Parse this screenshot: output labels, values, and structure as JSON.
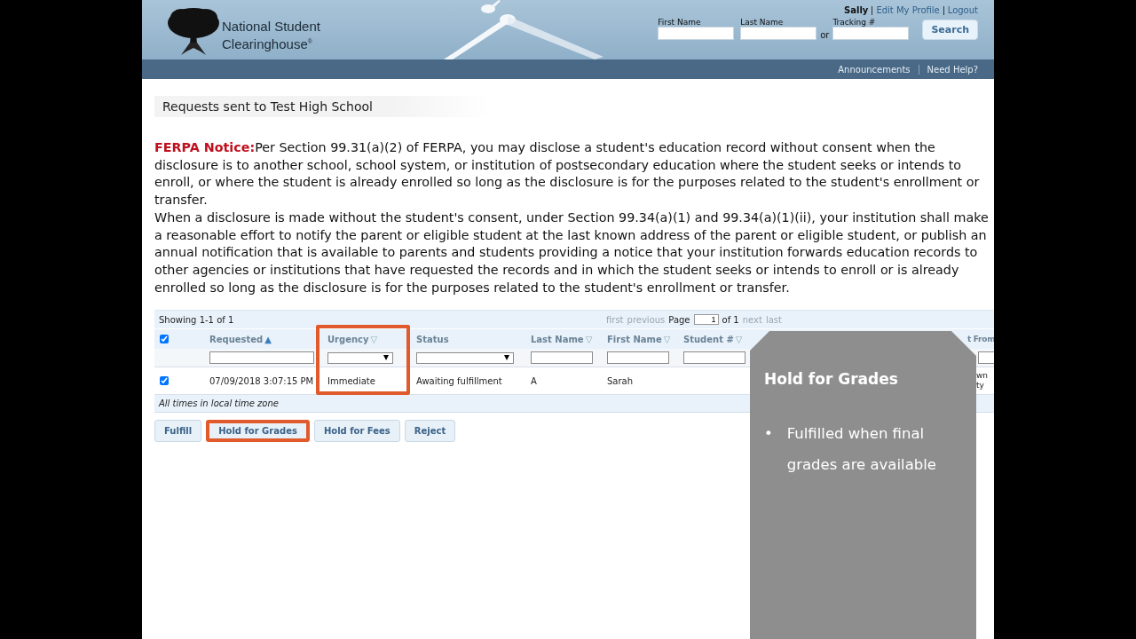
{
  "header": {
    "logo_lines": [
      "National Student",
      "Clearinghouse$^{®}$"
    ],
    "user": "Sally",
    "links": [
      "Edit My Profile",
      "Logout"
    ],
    "search_fields": [
      {
        "label": "First Name"
      },
      {
        "label": "Last Name"
      },
      {
        "label": "Tracking #"
      }
    ],
    "or": "or",
    "search_button": "Search"
  },
  "nav_links": [
    "Announcements",
    "Need Help?"
  ],
  "page_title": "Requests sent to Test High School",
  "notice": {
    "label": "FERPA Notice:",
    "paragraphs": [
      "Per Section 99.31(a)(2) of FERPA, you may disclose a student's education record without consent when the disclosure is to another school, school system, or institution of postsecondary education where the student seeks or intends to enroll, or where the student is already enrolled so long as the disclosure is for the purposes related to the student's enrollment or transfer.",
      "When a disclosure is made without the student's consent, under Section 99.34(a)(1) and 99.34(a)(1)(ii), your institution shall make a reasonable effort to notify the parent or eligible student at the last known address of the parent or eligible student, or publish an annual notification that is available to parents and students providing a notice that your institution forwards education records to other agencies or institutions that have requested the records and in which the student seeks or intends to enroll or is already enrolled so long as the disclosure is for the purposes related to the student's enrollment or transfer."
    ]
  },
  "table": {
    "showing": "Showing 1-1 of 1",
    "pager": {
      "first": "first",
      "previous": "previous",
      "page_label": "Page",
      "page": "1",
      "of": "of 1",
      "next": "next",
      "last": "last"
    },
    "select_all_checked": true,
    "columns": [
      {
        "label": "Requested",
        "sort_icon": "▲",
        "sorted": true,
        "kind": "text"
      },
      {
        "label": "Urgency",
        "sort_icon": "▽",
        "sorted": false,
        "kind": "select",
        "highlighted": true
      },
      {
        "label": "Status",
        "kind": "select"
      },
      {
        "label": "Last Name",
        "sort_icon": "▽",
        "sorted": false,
        "kind": "text"
      },
      {
        "label": "First Name",
        "sort_icon": "▽",
        "sorted": false,
        "kind": "text"
      },
      {
        "label": "Student #",
        "sort_icon": "▽",
        "sorted": false,
        "kind": "text"
      },
      {
        "label": "t From",
        "kind": "text"
      }
    ],
    "rows": [
      {
        "checked": true,
        "cells": [
          "07/09/2018 3:07:15 PM",
          "Immediate",
          "Awaiting fulfillment",
          "A",
          "Sarah",
          null,
          "wn ty"
        ]
      }
    ],
    "footnote": "All times in local time zone"
  },
  "actions": [
    {
      "label": "Fulfill",
      "highlighted": false
    },
    {
      "label": "Hold for Grades",
      "highlighted": true
    },
    {
      "label": "Hold for Fees",
      "highlighted": false
    },
    {
      "label": "Reject",
      "highlighted": false
    }
  ],
  "callout": {
    "title": "Hold for Grades",
    "bullets": [
      {
        "marker": "•",
        "text": "Fulfilled when final grades are available"
      }
    ]
  }
}
